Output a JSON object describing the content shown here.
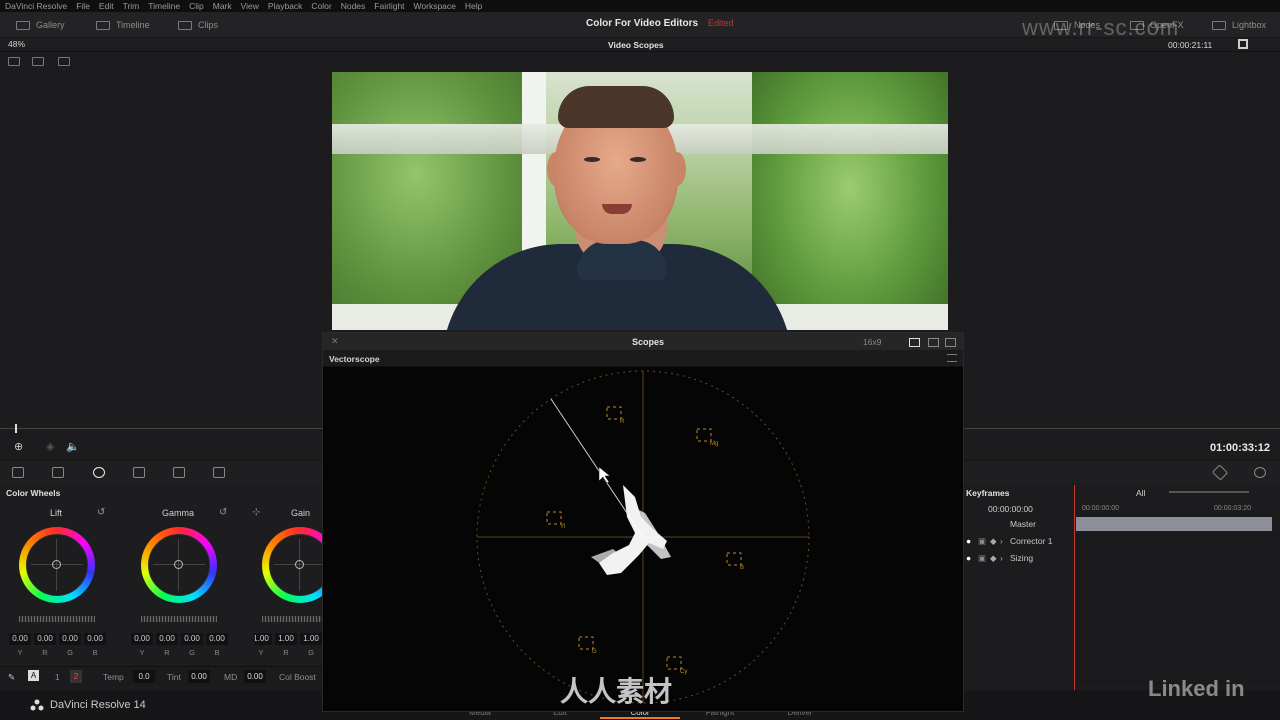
{
  "menubar": {
    "items": [
      "DaVinci Resolve",
      "File",
      "Edit",
      "Trim",
      "Timeline",
      "Clip",
      "Mark",
      "View",
      "Playback",
      "Color",
      "Nodes",
      "Fairlight",
      "Workspace",
      "Help"
    ]
  },
  "toolbar": {
    "gallery": "Gallery",
    "timeline": "Timeline",
    "clips": "Clips",
    "project_title": "Color For Video Editors",
    "edited": "Edited",
    "nodes": "Nodes",
    "openfx": "OpenFX",
    "lightbox": "Lightbox"
  },
  "viewer": {
    "zoom": "48%",
    "mode": "Video Scopes",
    "timecode": "00:00:21:11"
  },
  "scopes": {
    "title": "Scopes",
    "ratio": "16x9",
    "scope_type": "Vectorscope",
    "targets": [
      "R",
      "Mg",
      "B",
      "Cy",
      "G",
      "Yl"
    ]
  },
  "transport": {
    "timecode": "01:00:33:12"
  },
  "color_wheels": {
    "title": "Color Wheels",
    "wheels": [
      {
        "label": "Lift",
        "values": [
          "0.00",
          "0.00",
          "0.00",
          "0.00"
        ]
      },
      {
        "label": "Gamma",
        "values": [
          "0.00",
          "0.00",
          "0.00",
          "0.00"
        ]
      },
      {
        "label": "Gain",
        "values": [
          "1.00",
          "1.00",
          "1.00"
        ]
      }
    ],
    "channels": [
      "Y",
      "R",
      "G",
      "B"
    ]
  },
  "bottom_controls": {
    "page1": "1",
    "page2": "2",
    "temp_label": "Temp",
    "temp_value": "0.0",
    "tint_label": "Tint",
    "tint_value": "0.00",
    "md_label": "MD",
    "md_value": "0.00",
    "colboost_label": "Col Boost"
  },
  "keyframes": {
    "title": "Keyframes",
    "filter": "All",
    "timecode": "00:00:00:00",
    "ruler_start": "00:00:00:00",
    "ruler_end": "00:00:03:20",
    "rows": [
      "Master",
      "Corrector 1",
      "Sizing"
    ]
  },
  "app": {
    "name": "DaVinci Resolve 14",
    "pages": [
      "Media",
      "Edit",
      "Color",
      "Fairlight",
      "Deliver"
    ],
    "active_page": "Color"
  },
  "watermarks": {
    "linkedin": "Linked in",
    "site": "www.rr-sc.com",
    "cn": "人人素材"
  },
  "colors": {
    "accent": "#e67e22",
    "edited": "#c0392b",
    "scope_ring": "#7a5a1a"
  }
}
